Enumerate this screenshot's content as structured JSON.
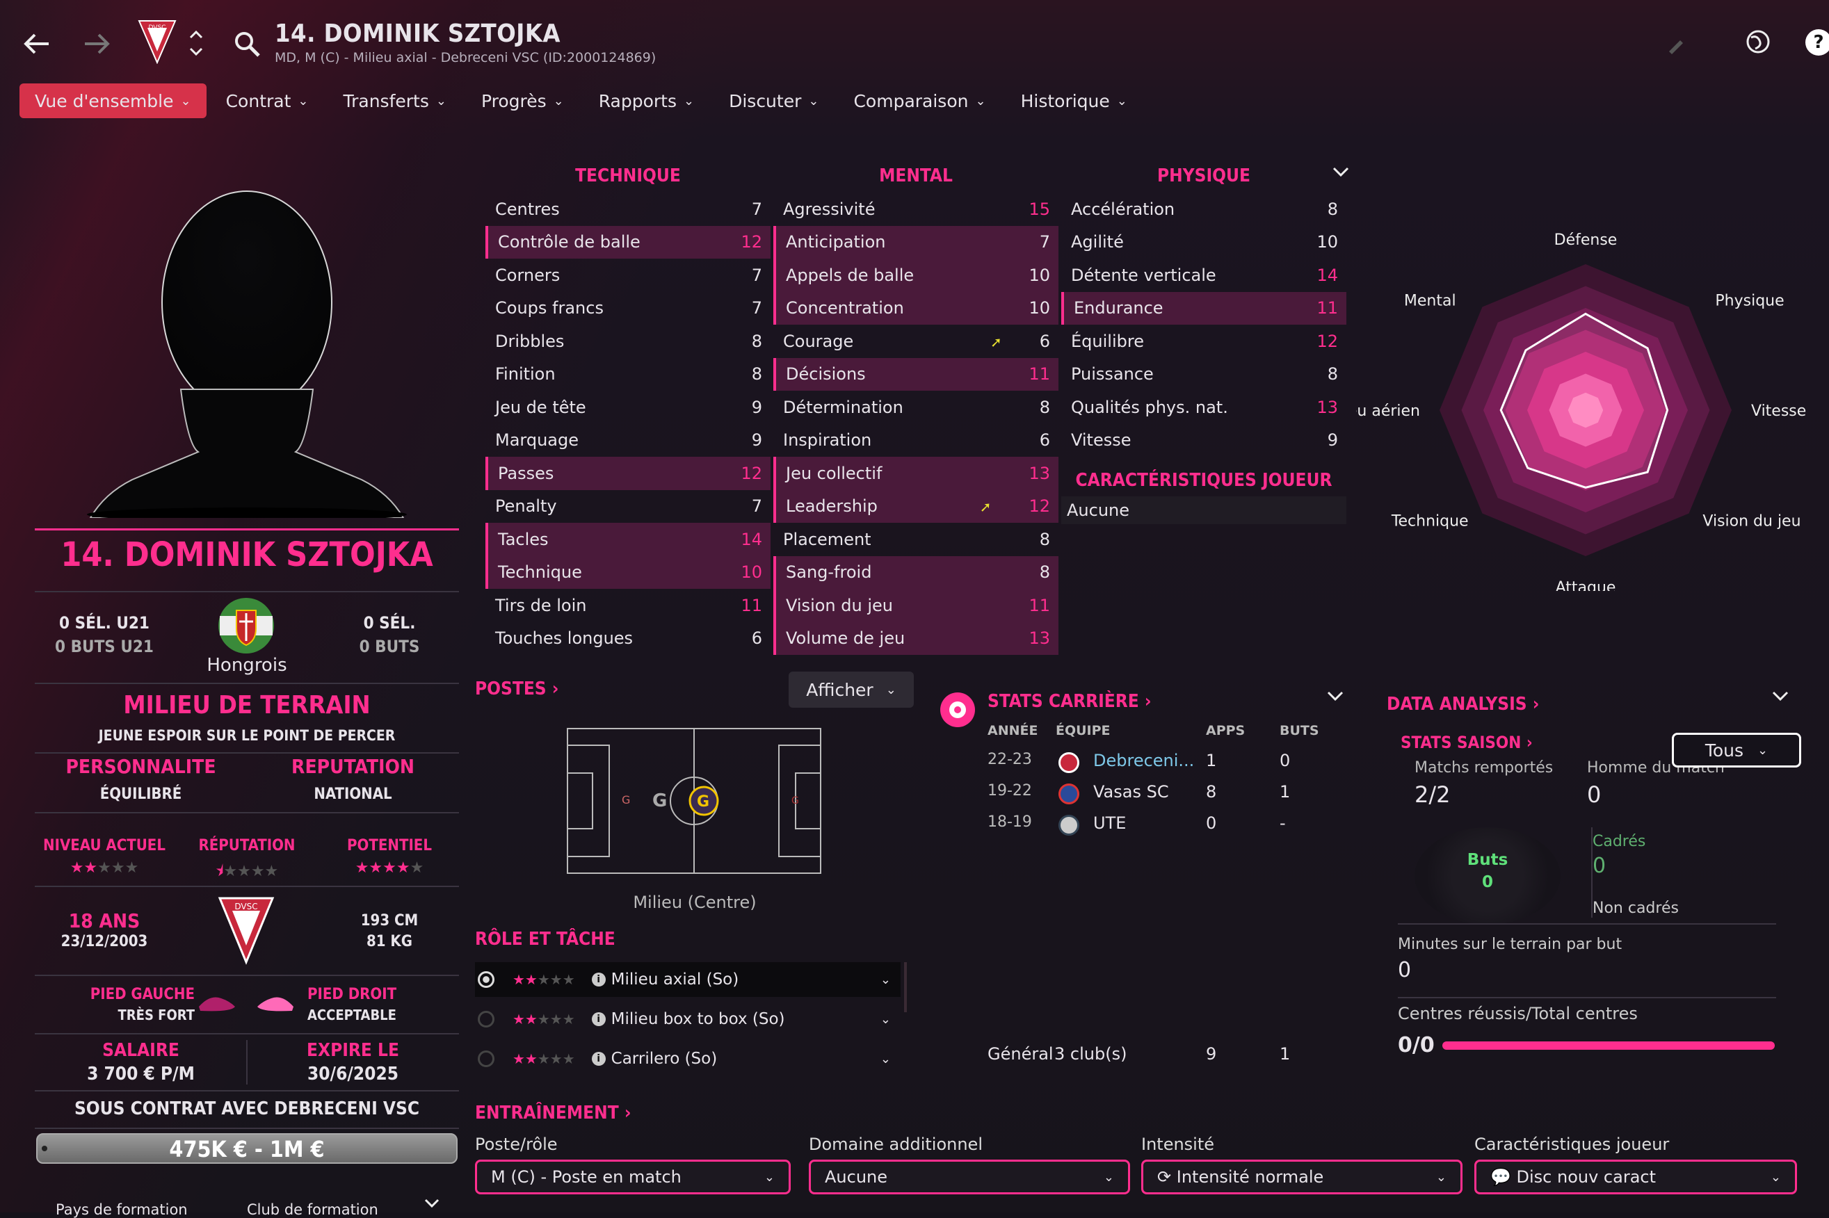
{
  "header": {
    "title": "14. DOMINIK SZTOJKA",
    "subtitle": "MD, M (C) - Milieu axial - Debreceni VSC (ID:2000124869)",
    "club_badge": "DVSC"
  },
  "tabs": [
    "Vue d'ensemble",
    "Contrat",
    "Transferts",
    "Progrès",
    "Rapports",
    "Discuter",
    "Comparaison",
    "Historique"
  ],
  "profile": {
    "name": "14. DOMINIK SZTOJKA",
    "u21_caps": "0 SÉL. U21",
    "u21_goals": "0 BUTS U21",
    "nationality": "Hongrois",
    "caps": "0 SÉL.",
    "goals": "0 BUTS",
    "position": "MILIEU DE TERRAIN",
    "tagline": "JEUNE ESPOIR SUR LE POINT DE PERCER",
    "personality_label": "PERSONNALITE",
    "personality": "ÉQUILIBRÉ",
    "reputation_label": "REPUTATION",
    "reputation": "NATIONAL",
    "level_label": "NIVEAU ACTUEL",
    "rep_label": "RÉPUTATION",
    "potential_label": "POTENTIEL",
    "level_stars": 2,
    "rep_stars": 0.5,
    "potential_stars": 4,
    "age": "18 ANS",
    "dob": "23/12/2003",
    "height": "193 CM",
    "weight": "81 KG",
    "left_foot_label": "PIED GAUCHE",
    "left_foot": "TRÈS FORT",
    "right_foot_label": "PIED DROIT",
    "right_foot": "ACCEPTABLE",
    "salary_label": "SALAIRE",
    "salary": "3 700 € P/M",
    "expiry_label": "EXPIRE LE",
    "expiry": "30/6/2025",
    "contract": "SOUS CONTRAT AVEC DEBRECENI VSC",
    "value": "475K € - 1M €",
    "training_country": "Pays de formation",
    "training_club": "Club de formation"
  },
  "attributes": {
    "technique_title": "TECHNIQUE",
    "mental_title": "MENTAL",
    "physique_title": "PHYSIQUE",
    "technique": [
      [
        "Centres",
        "7"
      ],
      [
        "Contrôle de balle",
        "12"
      ],
      [
        "Corners",
        "7"
      ],
      [
        "Coups francs",
        "7"
      ],
      [
        "Dribbles",
        "8"
      ],
      [
        "Finition",
        "8"
      ],
      [
        "Jeu de tête",
        "9"
      ],
      [
        "Marquage",
        "9"
      ],
      [
        "Passes",
        "12"
      ],
      [
        "Penalty",
        "7"
      ],
      [
        "Tacles",
        "14"
      ],
      [
        "Technique",
        "10"
      ],
      [
        "Tirs de loin",
        "11"
      ],
      [
        "Touches longues",
        "6"
      ]
    ],
    "mental": [
      [
        "Agressivité",
        "15"
      ],
      [
        "Anticipation",
        "7"
      ],
      [
        "Appels de balle",
        "10"
      ],
      [
        "Concentration",
        "10"
      ],
      [
        "Courage",
        "6"
      ],
      [
        "Décisions",
        "11"
      ],
      [
        "Détermination",
        "8"
      ],
      [
        "Inspiration",
        "6"
      ],
      [
        "Jeu collectif",
        "13"
      ],
      [
        "Leadership",
        "12"
      ],
      [
        "Placement",
        "8"
      ],
      [
        "Sang-froid",
        "8"
      ],
      [
        "Vision du jeu",
        "11"
      ],
      [
        "Volume de jeu",
        "13"
      ]
    ],
    "physique": [
      [
        "Accélération",
        "8"
      ],
      [
        "Agilité",
        "10"
      ],
      [
        "Détente verticale",
        "14"
      ],
      [
        "Endurance",
        "11"
      ],
      [
        "Équilibre",
        "12"
      ],
      [
        "Puissance",
        "8"
      ],
      [
        "Qualités phys. nat.",
        "13"
      ],
      [
        "Vitesse",
        "9"
      ]
    ],
    "traits_title": "CARACTÉRISTIQUES JOUEUR",
    "traits": "Aucune"
  },
  "radar": {
    "labels": [
      "Défense",
      "Physique",
      "Vitesse",
      "Vision du jeu",
      "Attaque",
      "Technique",
      "Jeu aérien",
      "Mental"
    ],
    "values": [
      0.66,
      0.6,
      0.56,
      0.6,
      0.53,
      0.56,
      0.58,
      0.58
    ]
  },
  "positions": {
    "title": "POSTES",
    "button": "Afficher",
    "caption": "Milieu (Centre)",
    "marker_g": "G"
  },
  "roles": {
    "title": "RÔLE ET TÂCHE",
    "items": [
      {
        "label": "Milieu axial (So)",
        "stars": 2
      },
      {
        "label": "Milieu box to box (So)",
        "stars": 2
      },
      {
        "label": "Carrilero (So)",
        "stars": 2
      }
    ]
  },
  "career": {
    "title": "STATS CARRIÈRE",
    "headers": [
      "ANNÉE",
      "ÉQUIPE",
      "APPS",
      "BUTS"
    ],
    "rows": [
      [
        "22-23",
        "Debreceni...",
        "1",
        "0"
      ],
      [
        "19-22",
        "Vasas SC",
        "8",
        "1"
      ],
      [
        "18-19",
        "UTE",
        "0",
        "-"
      ]
    ],
    "total": [
      "Général",
      "3 club(s)",
      "9",
      "1"
    ]
  },
  "data_analysis": {
    "title": "DATA ANALYSIS",
    "stats_title": "STATS SAISON",
    "filter": "Tous",
    "matches_won_label": "Matchs remportés",
    "matches_won": "2/2",
    "motm_label": "Homme du match",
    "motm": "0",
    "goals_label": "Buts",
    "goals": "0",
    "on_target_label": "Cadrés",
    "on_target": "0",
    "off_target_label": "Non cadrés",
    "mins_per_goal_label": "Minutes sur le terrain par but",
    "mins_per_goal": "0",
    "crosses_label": "Centres réussis/Total centres",
    "crosses": "0/0"
  },
  "training": {
    "title": "ENTRAÎNEMENT",
    "role_label": "Poste/rôle",
    "role": "M (C) - Poste en match",
    "extra_label": "Domaine additionnel",
    "extra": "Aucune",
    "intensity_label": "Intensité",
    "intensity": "Intensité normale",
    "trait_label": "Caractéristiques joueur",
    "trait": "Disc nouv caract"
  },
  "colors": {
    "accent": "#ff2e8e",
    "active_tab": "#d6324a",
    "highlight_row": "#4a1a3a"
  }
}
